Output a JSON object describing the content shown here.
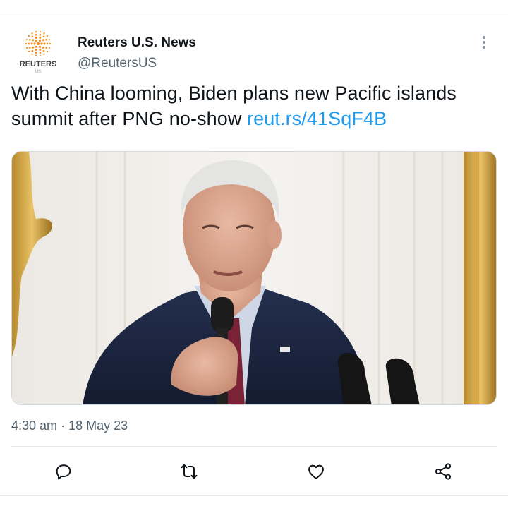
{
  "author": {
    "name": "Reuters U.S. News",
    "handle": "@ReutersUS",
    "logo_wordmark": "REUTERS",
    "logo_sub": "US",
    "avatar_icon": "reuters-logo-icon"
  },
  "tweet": {
    "text": "With China looming, Biden plans new Pacific islands summit after PNG no-show ",
    "link": "reut.rs/41SqF4B",
    "media_description_icon": "photo-image",
    "time": "4:30 am",
    "separator": "·",
    "date": "18 May 23"
  },
  "actions": [
    {
      "name": "reply",
      "icon": "reply-icon"
    },
    {
      "name": "retweet",
      "icon": "retweet-icon"
    },
    {
      "name": "like",
      "icon": "heart-icon"
    },
    {
      "name": "share",
      "icon": "share-icon"
    }
  ],
  "colors": {
    "link": "#1d9bf0",
    "secondary_text": "#536471",
    "logo_orange": "#f28c1a"
  }
}
